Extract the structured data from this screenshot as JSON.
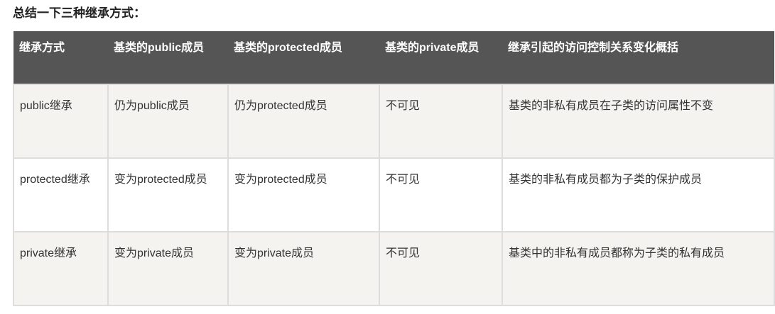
{
  "title": "总结一下三种继承方式：",
  "table": {
    "headers": [
      "继承方式",
      "基类的public成员",
      "基类的protected成员",
      "基类的private成员",
      "继承引起的访问控制关系变化概括"
    ],
    "rows": [
      [
        "public继承",
        "仍为public成员",
        "仍为protected成员",
        "不可见",
        "基类的非私有成员在子类的访问属性不变"
      ],
      [
        "protected继承",
        "变为protected成员",
        "变为protected成员",
        "不可见",
        "基类的非私有成员都为子类的保护成员"
      ],
      [
        "private继承",
        "变为private成员",
        "变为private成员",
        "不可见",
        "基类中的非私有成员都称为子类的私有成员"
      ]
    ]
  },
  "colors": {
    "header_bg": "#555555",
    "row_alt_bg": "#f4f3f0",
    "border": "#dddddd"
  }
}
